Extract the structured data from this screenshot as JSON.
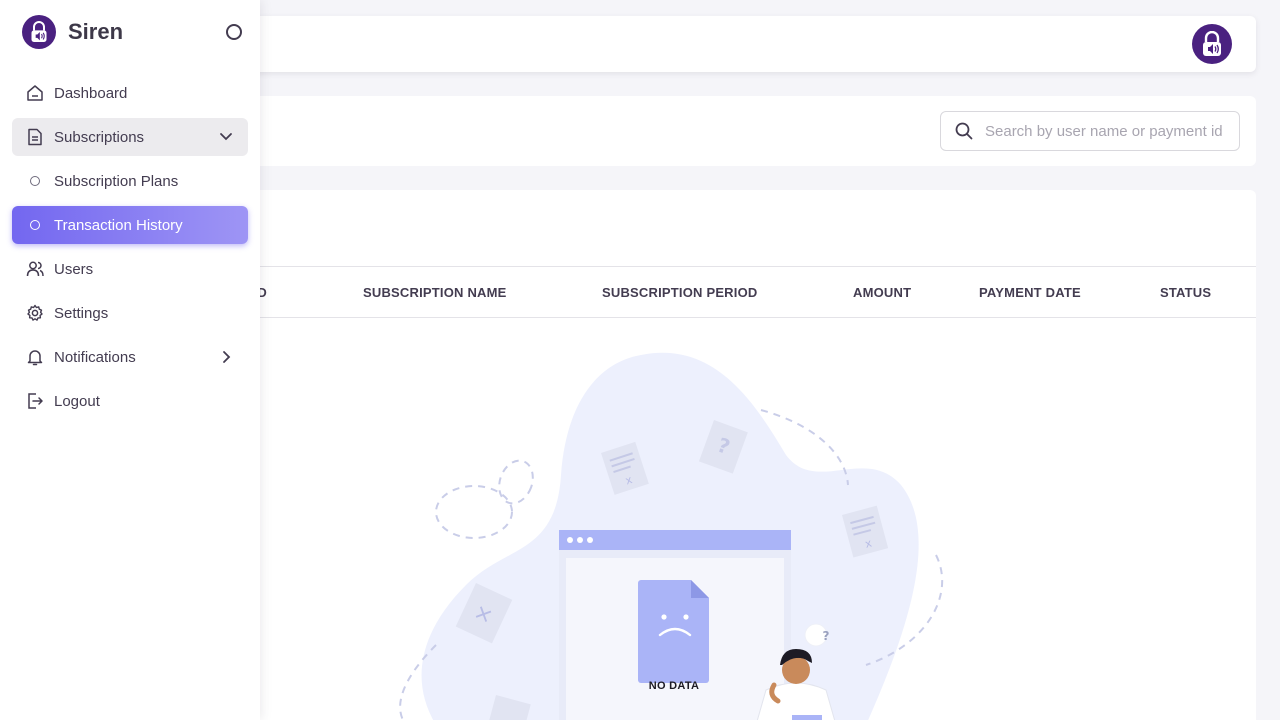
{
  "app": {
    "name": "Siren"
  },
  "colors": {
    "brand": "#4a2180",
    "accent": "#7367f0",
    "illustration": "#aab4f7"
  },
  "sidebar": {
    "items": [
      {
        "label": "Dashboard",
        "icon": "home-icon"
      },
      {
        "label": "Subscriptions",
        "icon": "document-icon",
        "expanded": true
      },
      {
        "label": "Subscription Plans",
        "icon": "circle-icon"
      },
      {
        "label": "Transaction History",
        "icon": "circle-icon",
        "active": true
      },
      {
        "label": "Users",
        "icon": "users-icon"
      },
      {
        "label": "Settings",
        "icon": "gear-icon"
      },
      {
        "label": "Notifications",
        "icon": "bell-icon"
      },
      {
        "label": "Logout",
        "icon": "logout-icon"
      }
    ]
  },
  "search": {
    "placeholder": "Search by user name or payment id"
  },
  "table": {
    "columns": [
      "NT ID",
      "SUBSCRIPTION NAME",
      "SUBSCRIPTION PERIOD",
      "AMOUNT",
      "PAYMENT DATE",
      "STATUS"
    ],
    "rows": []
  },
  "empty_state": {
    "label": "NO DATA",
    "question_mark": "?"
  }
}
